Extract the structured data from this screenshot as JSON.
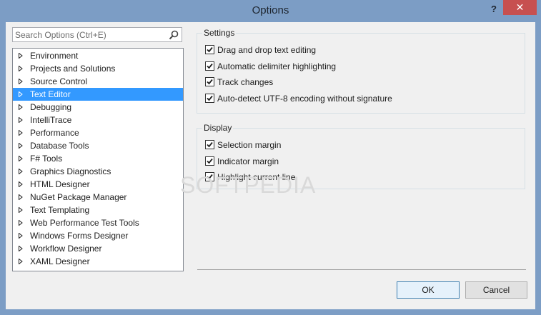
{
  "window": {
    "title": "Options",
    "help_label": "?",
    "close_label": "✕"
  },
  "search": {
    "placeholder": "Search Options (Ctrl+E)"
  },
  "tree": {
    "items": [
      {
        "label": "Environment",
        "selected": false
      },
      {
        "label": "Projects and Solutions",
        "selected": false
      },
      {
        "label": "Source Control",
        "selected": false
      },
      {
        "label": "Text Editor",
        "selected": true
      },
      {
        "label": "Debugging",
        "selected": false
      },
      {
        "label": "IntelliTrace",
        "selected": false
      },
      {
        "label": "Performance",
        "selected": false
      },
      {
        "label": "Database Tools",
        "selected": false
      },
      {
        "label": "F# Tools",
        "selected": false
      },
      {
        "label": "Graphics Diagnostics",
        "selected": false
      },
      {
        "label": "HTML Designer",
        "selected": false
      },
      {
        "label": "NuGet Package Manager",
        "selected": false
      },
      {
        "label": "Text Templating",
        "selected": false
      },
      {
        "label": "Web Performance Test Tools",
        "selected": false
      },
      {
        "label": "Windows Forms Designer",
        "selected": false
      },
      {
        "label": "Workflow Designer",
        "selected": false
      },
      {
        "label": "XAML Designer",
        "selected": false
      }
    ]
  },
  "settings": {
    "title": "Settings",
    "options": [
      {
        "label": "Drag and drop text editing",
        "checked": true
      },
      {
        "label": "Automatic delimiter highlighting",
        "checked": true
      },
      {
        "label": "Track changes",
        "checked": true
      },
      {
        "label": "Auto-detect UTF-8 encoding without signature",
        "checked": true
      }
    ]
  },
  "display": {
    "title": "Display",
    "options": [
      {
        "label": "Selection margin",
        "checked": true
      },
      {
        "label": "Indicator margin",
        "checked": true
      },
      {
        "label": "Highlight current line",
        "checked": true
      }
    ]
  },
  "buttons": {
    "ok_label": "OK",
    "cancel_label": "Cancel"
  },
  "watermark": "SOFTPEDIA",
  "colors": {
    "titlebar": "#7c9dc5",
    "close": "#c75050",
    "selection": "#3399ff"
  }
}
